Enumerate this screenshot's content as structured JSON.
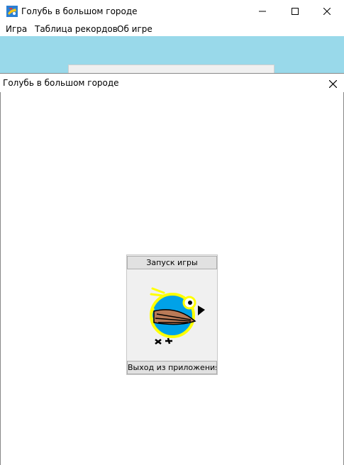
{
  "window": {
    "title": "Голубь в большом городе",
    "icon": "app-icon",
    "controls": [
      "minimize-icon",
      "maximize-icon",
      "close-icon"
    ]
  },
  "menu": {
    "items": [
      {
        "label": "Игра"
      },
      {
        "label": "Таблица рекордов"
      },
      {
        "label": "Об игре"
      }
    ]
  },
  "dialog": {
    "title": "Голубь в большом городе",
    "start_button": "Запуск игры",
    "exit_button": "Выход из приложения",
    "image": "pigeon-illustration"
  },
  "colors": {
    "client_background": "#99d9ea",
    "pigeon_body": "#00a2e8",
    "pigeon_outline": "#ffff00",
    "pigeon_wing": "#b97a57",
    "pigeon_beak": "#000000"
  }
}
